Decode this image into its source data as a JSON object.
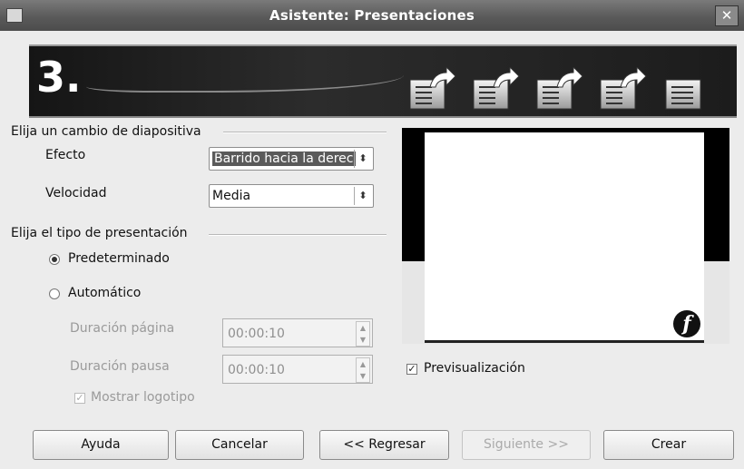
{
  "window": {
    "title": "Asistente: Presentaciones",
    "close_glyph": "✕"
  },
  "banner": {
    "step": "3.",
    "icons": [
      "slide-next-icon",
      "slide-next-icon",
      "slide-next-icon",
      "slide-next-icon",
      "slide-icon"
    ]
  },
  "transition": {
    "group_label": "Elija un cambio de diapositiva",
    "effect_label": "Efecto",
    "effect_value": "Barrido hacia la derec",
    "speed_label": "Velocidad",
    "speed_value": "Media"
  },
  "presentation": {
    "group_label": "Elija el tipo de presentación",
    "default_label": "Predeterminado",
    "auto_label": "Automático",
    "page_duration_label": "Duración página",
    "page_duration_value": "00:00:10",
    "pause_duration_label": "Duración pausa",
    "pause_duration_value": "00:00:10",
    "show_logo_label": "Mostrar logotipo"
  },
  "preview": {
    "checkbox_label": "Previsualización",
    "logo_glyph": "f"
  },
  "buttons": {
    "help": "Ayuda",
    "cancel": "Cancelar",
    "back": "<< Regresar",
    "next": "Siguiente >>",
    "create": "Crear"
  }
}
